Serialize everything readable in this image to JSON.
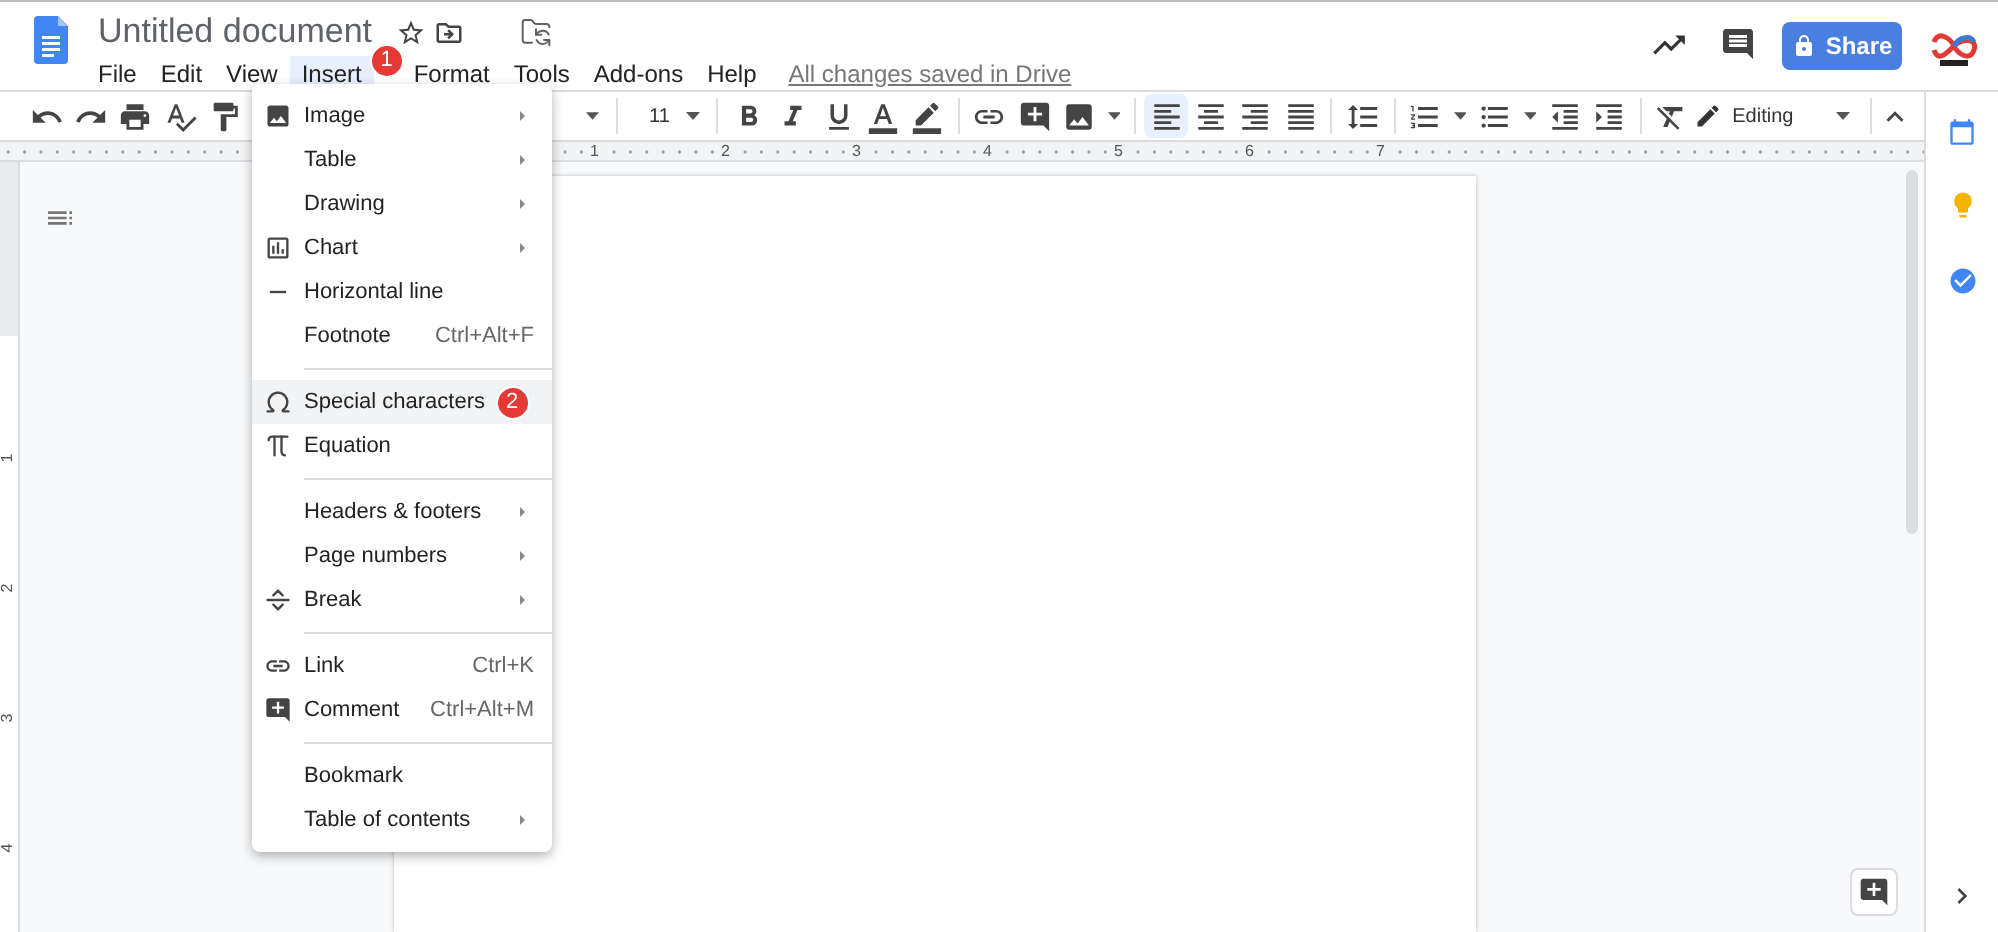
{
  "document": {
    "title": "Untitled document"
  },
  "menubar": [
    {
      "label": "File",
      "selected": false
    },
    {
      "label": "Edit",
      "selected": false
    },
    {
      "label": "View",
      "selected": false
    },
    {
      "label": "Insert",
      "selected": true,
      "badge": "1"
    },
    {
      "label": "Format",
      "selected": false
    },
    {
      "label": "Tools",
      "selected": false
    },
    {
      "label": "Add-ons",
      "selected": false
    },
    {
      "label": "Help",
      "selected": false
    }
  ],
  "save_status": "All changes saved in Drive",
  "share_button": {
    "label": "Share"
  },
  "toolbar": {
    "font_size": "11",
    "alignment": [
      {
        "kind": "left",
        "selected": true
      },
      {
        "kind": "center",
        "selected": false
      },
      {
        "kind": "right",
        "selected": false
      },
      {
        "kind": "justify",
        "selected": false
      }
    ],
    "mode": "Editing"
  },
  "ruler": {
    "horizontal": [
      "1",
      "2",
      "3",
      "4",
      "5",
      "6",
      "7"
    ],
    "vertical": [
      "1",
      "2",
      "3",
      "4"
    ]
  },
  "insert_menu": [
    {
      "kind": "item",
      "label": "Image",
      "submenu": true,
      "selected": false
    },
    {
      "kind": "item",
      "label": "Table",
      "submenu": true,
      "selected": false
    },
    {
      "kind": "item",
      "label": "Drawing",
      "submenu": true,
      "selected": false
    },
    {
      "kind": "item",
      "label": "Chart",
      "submenu": true,
      "selected": false
    },
    {
      "kind": "item",
      "label": "Horizontal line",
      "submenu": false,
      "selected": false
    },
    {
      "kind": "item",
      "label": "Footnote",
      "shortcut": "Ctrl+Alt+F",
      "submenu": false,
      "selected": false
    },
    {
      "kind": "separator"
    },
    {
      "kind": "item",
      "label": "Special characters",
      "submenu": false,
      "selected": true,
      "badge": "2"
    },
    {
      "kind": "item",
      "label": "Equation",
      "submenu": false,
      "selected": false
    },
    {
      "kind": "separator"
    },
    {
      "kind": "item",
      "label": "Headers & footers",
      "submenu": true,
      "selected": false
    },
    {
      "kind": "item",
      "label": "Page numbers",
      "submenu": true,
      "selected": false
    },
    {
      "kind": "item",
      "label": "Break",
      "submenu": true,
      "selected": false
    },
    {
      "kind": "separator"
    },
    {
      "kind": "item",
      "label": "Link",
      "shortcut": "Ctrl+K",
      "submenu": false,
      "selected": false
    },
    {
      "kind": "item",
      "label": "Comment",
      "shortcut": "Ctrl+Alt+M",
      "submenu": false,
      "selected": false
    },
    {
      "kind": "separator"
    },
    {
      "kind": "item",
      "label": "Bookmark",
      "submenu": false,
      "selected": false
    },
    {
      "kind": "item",
      "label": "Table of contents",
      "submenu": true,
      "selected": false
    }
  ]
}
